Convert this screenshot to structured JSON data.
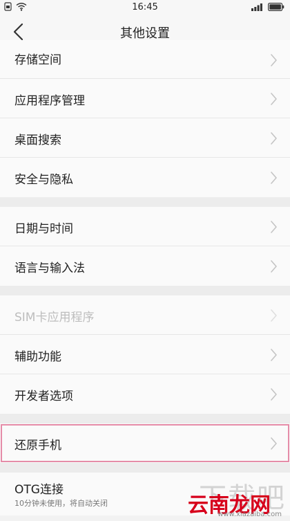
{
  "status_bar": {
    "time": "16:45"
  },
  "nav": {
    "title": "其他设置"
  },
  "groups": [
    {
      "items": [
        {
          "label": "存储空间"
        },
        {
          "label": "应用程序管理"
        },
        {
          "label": "桌面搜索"
        },
        {
          "label": "安全与隐私"
        }
      ]
    },
    {
      "items": [
        {
          "label": "日期与时间"
        },
        {
          "label": "语言与输入法"
        }
      ]
    },
    {
      "items": [
        {
          "label": "SIM卡应用程序",
          "disabled": true
        },
        {
          "label": "辅助功能"
        },
        {
          "label": "开发者选项"
        }
      ]
    },
    {
      "items": [
        {
          "label": "还原手机"
        }
      ]
    },
    {
      "items": [
        {
          "label": "OTG连接",
          "sublabel": "10分钟未使用，将自动关闭"
        }
      ]
    }
  ],
  "watermark": {
    "brand": "云南龙网",
    "big": "下载吧",
    "url": "www.xiazaiba.com"
  },
  "colors": {
    "highlight_outline": "#e58ca8",
    "disabled_text": "#bdbdbd",
    "watermark_red": "#d7001b"
  }
}
